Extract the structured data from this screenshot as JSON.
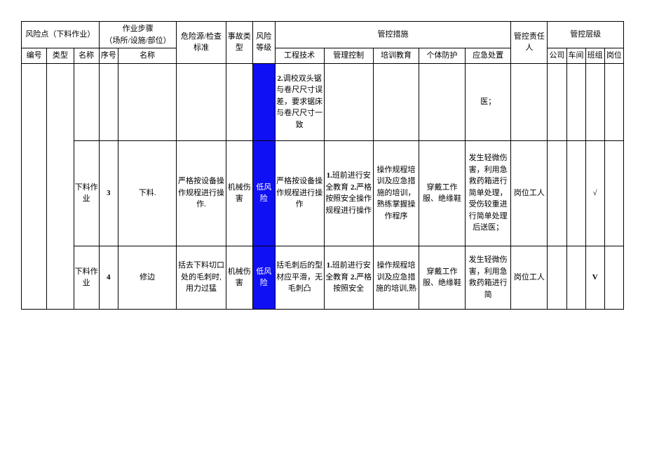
{
  "headers": {
    "risk_point": "风险点（下料作业）",
    "step": "作业步骤\n（场所/设施/部位）",
    "hazard": "危险源/检查标准",
    "accident_type": "事故类型",
    "risk_level": "风险等级",
    "control_measures": "管控措施",
    "responsible": "管控责任人",
    "control_level": "管控层级",
    "no": "编号",
    "type": "类型",
    "name": "名称",
    "seq": "序号",
    "step_name": "名称",
    "engineering": "工程技术",
    "management": "管理控制",
    "training": "培训教育",
    "ppe": "个体防护",
    "emergency": "应急处置",
    "company": "公司",
    "workshop": "车间",
    "team": "班组",
    "post": "岗位"
  },
  "rows": [
    {
      "no": "",
      "type": "",
      "name": "",
      "seq": "",
      "step_name": "",
      "hazard": "",
      "accident_type": "",
      "risk_level": "",
      "engineering": "2.调校双头锯与卷尺尺寸误差，要求锯床与卷尺尺寸一致",
      "management": "",
      "training": "",
      "ppe": "",
      "emergency": "医；",
      "responsible": "",
      "company": "",
      "workshop": "",
      "team": "",
      "post": ""
    },
    {
      "no": "",
      "type": "",
      "name": "下料作业",
      "seq": "3",
      "step_name": "下料.",
      "hazard": "严格按设备操作规程进行操作.",
      "accident_type": "机械伤害",
      "risk_level": "低风险",
      "engineering": "严格按设备操作规程进行操作",
      "management": "1.班前进行安全教育 2.严格按照安全操作规程进行操作",
      "training": "操作规程培训及应急措施的培训，熟练掌握操作程序",
      "ppe": "穿戴工作服、绝缘鞋",
      "emergency": "发生轻微伤害，利用急救药箱进行简单处理，受伤较重进行简单处理后送医；",
      "responsible": "岗位工人",
      "company": "",
      "workshop": "",
      "team": "√",
      "post": ""
    },
    {
      "no": "",
      "type": "",
      "name": "下料作业",
      "seq": "4",
      "step_name": "修边",
      "hazard": "括去下料切口处的毛刺时,用力过猛",
      "accident_type": "机械伤害",
      "risk_level": "低风险",
      "engineering": "括毛刺后的型材应平滑，无毛刺凸",
      "management": "1.班前进行安全教育 2.严格按照安全",
      "training": "操作规程培训及应急措施的培训,熟",
      "ppe": "穿戴工作服、绝缘鞋",
      "emergency": "发生轻微伤害，利用急救药箱进行简",
      "responsible": "岗位工人",
      "company": "",
      "workshop": "",
      "team": "V",
      "post": ""
    }
  ]
}
